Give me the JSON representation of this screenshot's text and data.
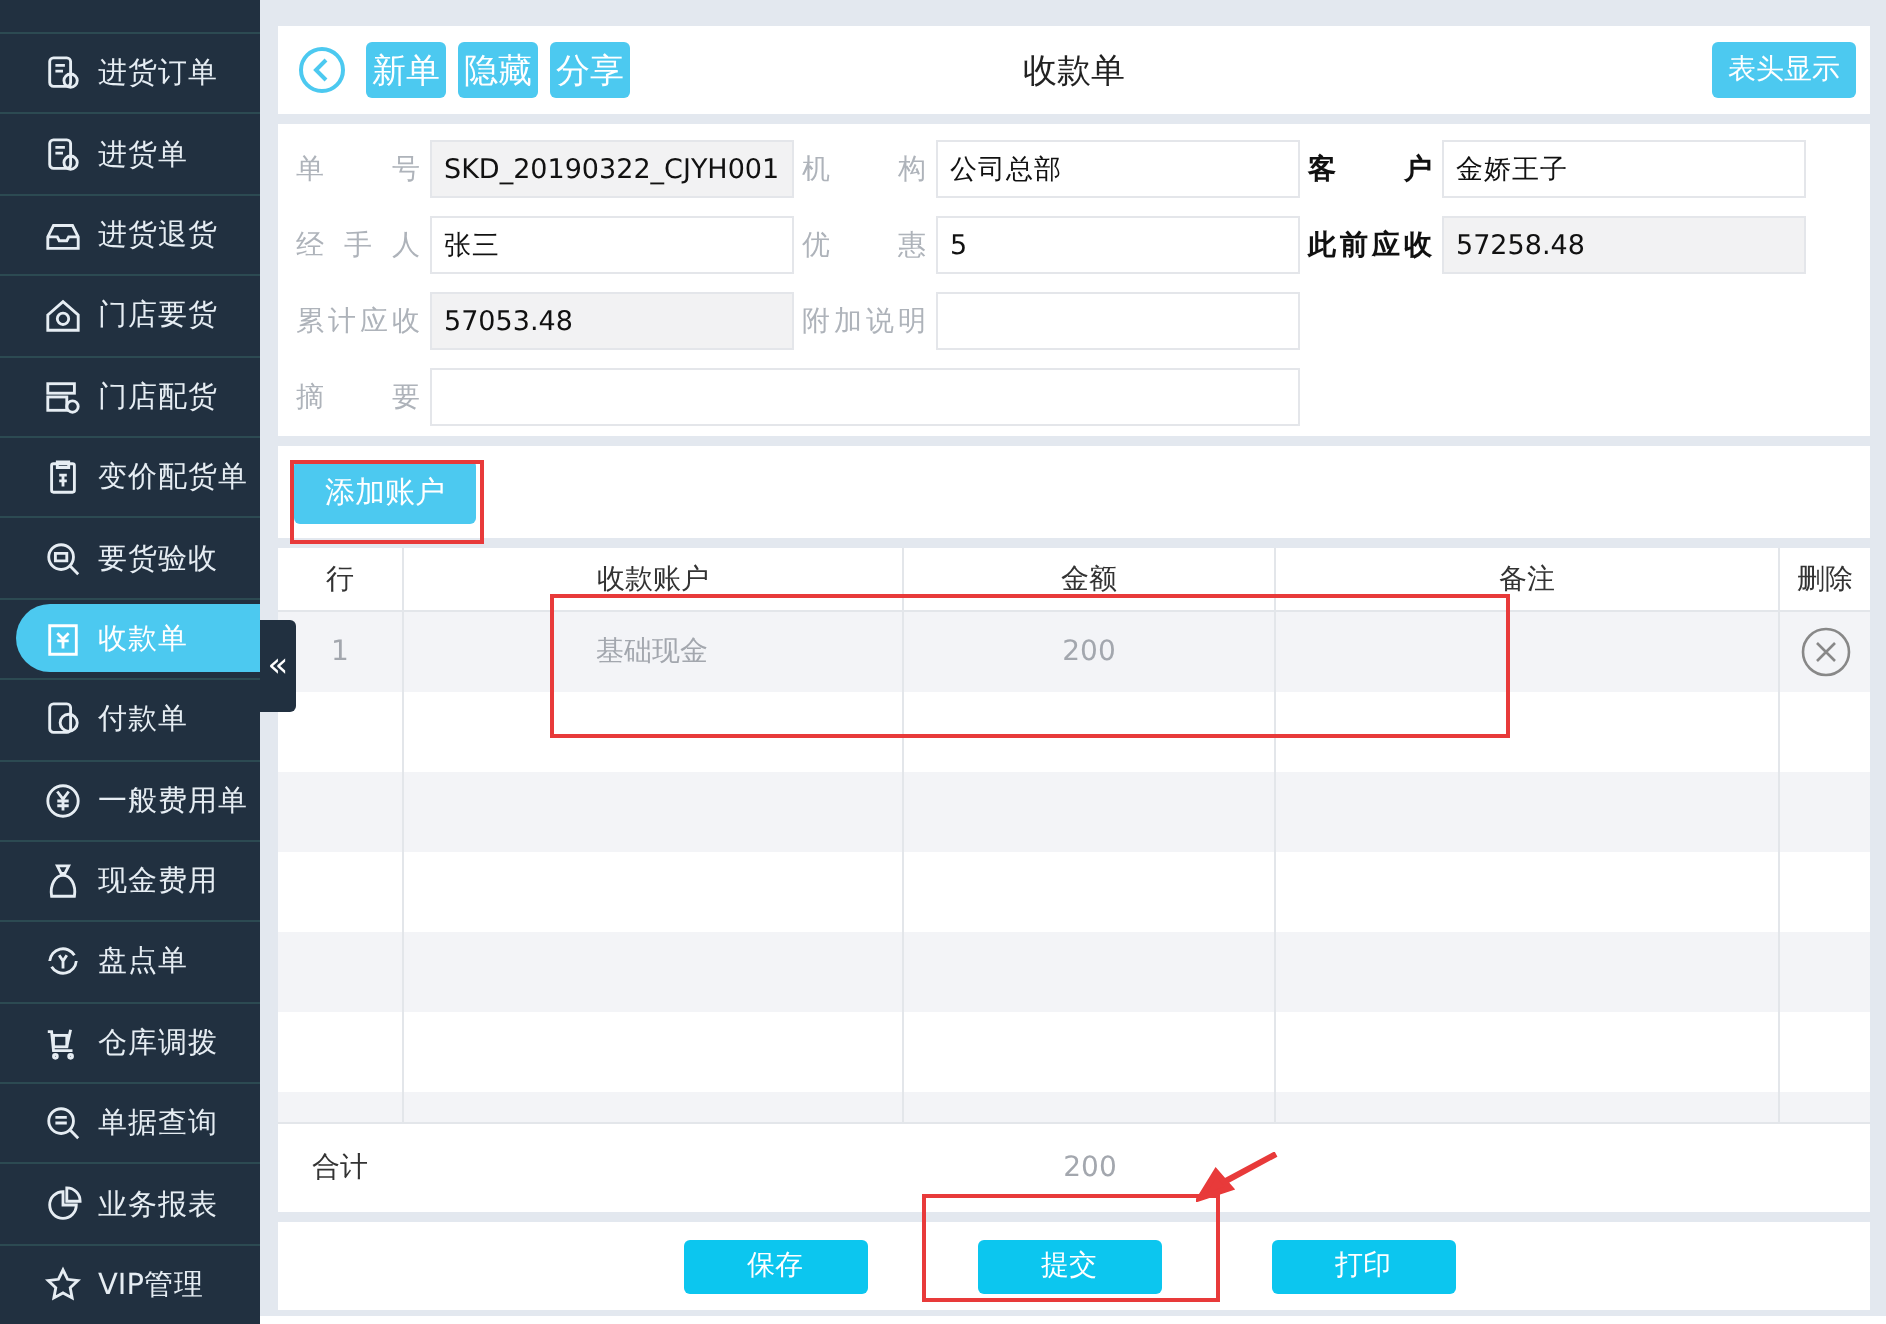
{
  "sidebar": {
    "items": [
      {
        "label": "进货订单",
        "selected": false
      },
      {
        "label": "进货单",
        "selected": false
      },
      {
        "label": "进货退货",
        "selected": false
      },
      {
        "label": "门店要货",
        "selected": false
      },
      {
        "label": "门店配货",
        "selected": false
      },
      {
        "label": "变价配货单",
        "selected": false
      },
      {
        "label": "要货验收",
        "selected": false
      },
      {
        "label": "收款单",
        "selected": true
      },
      {
        "label": "付款单",
        "selected": false
      },
      {
        "label": "一般费用单",
        "selected": false
      },
      {
        "label": "现金费用",
        "selected": false
      },
      {
        "label": "盘点单",
        "selected": false
      },
      {
        "label": "仓库调拨",
        "selected": false
      },
      {
        "label": "单据查询",
        "selected": false
      },
      {
        "label": "业务报表",
        "selected": false
      },
      {
        "label": "VIP管理",
        "selected": false
      }
    ],
    "collapse": "«"
  },
  "header": {
    "buttons": [
      "新单",
      "隐藏",
      "分享"
    ],
    "title": "收款单",
    "right_button": "表头显示"
  },
  "form": {
    "fields": [
      {
        "label": "单号",
        "value": "SKD_20190322_CJYH001",
        "readonly": true,
        "emphasized": false,
        "wide": false
      },
      {
        "label": "机构",
        "value": "公司总部",
        "readonly": false,
        "emphasized": false,
        "wide": false
      },
      {
        "label": "客户",
        "value": "金娇王子",
        "readonly": false,
        "emphasized": true,
        "wide": false
      },
      {
        "label": "经手人",
        "value": "张三",
        "readonly": false,
        "emphasized": false,
        "wide": false
      },
      {
        "label": "优惠",
        "value": "5",
        "readonly": false,
        "emphasized": false,
        "wide": false
      },
      {
        "label": "此前应收",
        "value": "57258.48",
        "readonly": true,
        "emphasized": true,
        "wide": false
      },
      {
        "label": "累计应收",
        "value": "57053.48",
        "readonly": true,
        "emphasized": false,
        "wide": false
      },
      {
        "label": "附加说明",
        "readonly": false,
        "emphasized": false,
        "wide": false
      },
      {
        "label": "摘要",
        "readonly": false,
        "emphasized": false,
        "wide": true
      }
    ]
  },
  "add_account_button": "添加账户",
  "table": {
    "columns": [
      "行",
      "收款账户",
      "金额",
      "备注",
      "删除"
    ],
    "rows": [
      {
        "line": "1",
        "account": "基础现金",
        "amount": "200"
      }
    ],
    "total_label": "合计",
    "total_amount": "200"
  },
  "footer_buttons": [
    "保存",
    "提交",
    "打印"
  ]
}
